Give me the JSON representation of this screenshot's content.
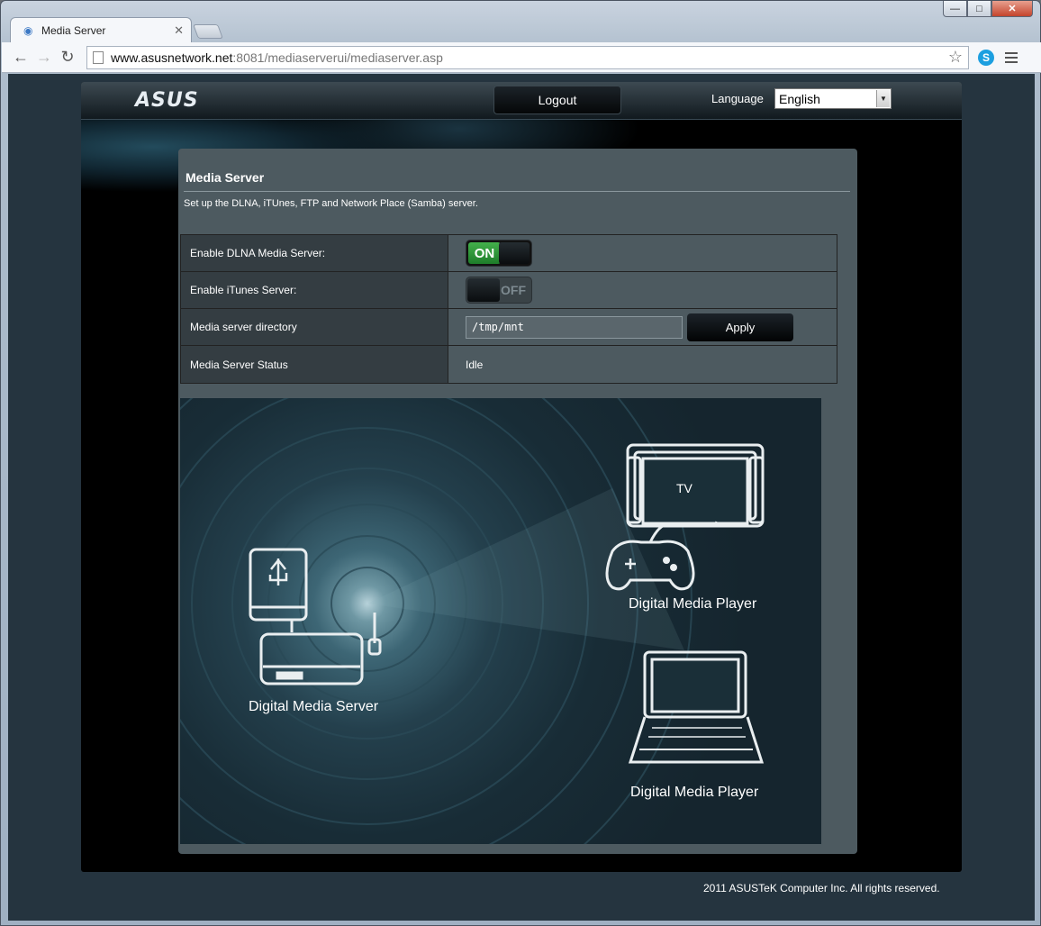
{
  "browser": {
    "tab_title": "Media Server",
    "url_host": "www.asusnetwork.net",
    "url_rest": ":8081/mediaserverui/mediaserver.asp"
  },
  "header": {
    "logo": "ASUS",
    "logout_label": "Logout",
    "language_label": "Language",
    "language_value": "English"
  },
  "panel": {
    "title": "Media Server",
    "description": "Set up the DLNA, iTUnes, FTP and Network Place (Samba) server."
  },
  "settings": {
    "dlna_label": "Enable DLNA Media Server:",
    "dlna_state": "ON",
    "itunes_label": "Enable iTunes Server:",
    "itunes_state": "OFF",
    "directory_label": "Media server directory",
    "directory_value": "/tmp/mnt",
    "apply_label": "Apply",
    "status_label": "Media Server Status",
    "status_value": "Idle"
  },
  "diagram": {
    "tv_label": "TV",
    "server_label": "Digital  Media Server",
    "player1_label": "Digital  Media Player",
    "player2_label": "Digital  Media Player"
  },
  "footer": {
    "copyright": "2011 ASUSTeK Computer Inc. All rights reserved."
  }
}
